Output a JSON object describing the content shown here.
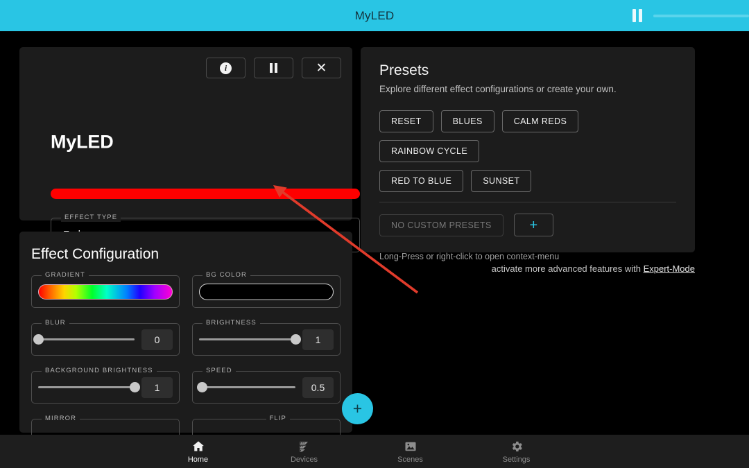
{
  "appbar": {
    "title": "MyLED",
    "pause_icon": "pause-icon",
    "slider_icon": "brightness-slider"
  },
  "device_card": {
    "name": "MyLED",
    "color_bar_hex": "#ff0000",
    "actions": [
      {
        "name": "info-button",
        "icon": "info-icon",
        "label": "i"
      },
      {
        "name": "pause-button",
        "icon": "pause-icon",
        "label": ""
      },
      {
        "name": "close-button",
        "icon": "close-icon",
        "label": "✕"
      }
    ],
    "effect_type": {
      "legend": "EFFECT TYPE",
      "value": "Fade",
      "caret": "chevron-down-icon"
    }
  },
  "effect_config": {
    "title": "Effect Configuration",
    "collapse_icon": "chevron-up-icon",
    "fields": {
      "gradient": {
        "legend": "GRADIENT",
        "type": "gradient-swatch"
      },
      "bg_color": {
        "legend": "BG COLOR",
        "value_hex": "#000000"
      },
      "blur": {
        "legend": "BLUR",
        "value": "0",
        "percent": 0
      },
      "brightness": {
        "legend": "BRIGHTNESS",
        "value": "1",
        "percent": 100
      },
      "background_brightness": {
        "legend": "BACKGROUND BRIGHTNESS",
        "value": "1",
        "percent": 100
      },
      "speed": {
        "legend": "SPEED",
        "value": "0.5",
        "percent": 3
      },
      "mirror": {
        "legend": "MIRROR"
      },
      "flip": {
        "legend": "FLIP"
      }
    }
  },
  "presets": {
    "title": "Presets",
    "subtitle": "Explore different effect configurations or create your own.",
    "buttons_row1": [
      "RESET",
      "BLUES",
      "CALM REDS",
      "RAINBOW CYCLE"
    ],
    "buttons_row2": [
      "RED TO BLUE",
      "SUNSET"
    ],
    "custom_empty_label": "NO CUSTOM PRESETS",
    "add_button_label": "+",
    "hint": "Long-Press or right-click to open context-menu"
  },
  "expert": {
    "text": "activate more advanced features with ",
    "link": "Expert-Mode"
  },
  "fab": {
    "label": "+",
    "color_hex": "#29c5e4"
  },
  "bottom_nav": {
    "items": [
      {
        "label": "Home",
        "icon": "home-icon",
        "active": true
      },
      {
        "label": "Devices",
        "icon": "led-strip-icon",
        "active": false
      },
      {
        "label": "Scenes",
        "icon": "image-icon",
        "active": false
      },
      {
        "label": "Settings",
        "icon": "gear-icon",
        "active": false
      }
    ]
  },
  "annotation": {
    "color_hex": "#e03b2b",
    "target": "effect-type-dropdown"
  }
}
